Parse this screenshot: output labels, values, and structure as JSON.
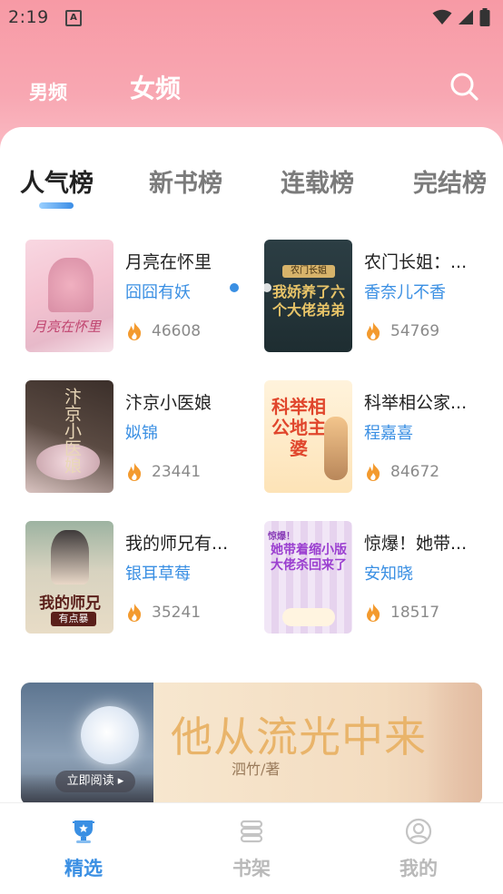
{
  "status_bar": {
    "time": "2:19",
    "notification_letter": "A"
  },
  "header": {
    "tabs": [
      {
        "label": "男频",
        "active": false
      },
      {
        "label": "女频",
        "active": true
      }
    ]
  },
  "rank_tabs": [
    {
      "label": "人气榜",
      "active": true
    },
    {
      "label": "新书榜",
      "active": false
    },
    {
      "label": "连载榜",
      "active": false
    },
    {
      "label": "完结榜",
      "active": false
    }
  ],
  "books": [
    {
      "title": "月亮在怀里",
      "author": "囧囧有妖",
      "heat": "46608",
      "cover_text": "月亮在怀里"
    },
    {
      "title": "农门长姐：...",
      "author": "香奈儿不香",
      "heat": "54769",
      "cover_text": "我娇养了六个大佬弟弟",
      "cover_top_text": "农门长姐"
    },
    {
      "title": "汴京小医娘",
      "author": "姒锦",
      "heat": "23441",
      "cover_text": "汴京小医娘"
    },
    {
      "title": "科举相公家...",
      "author": "程嘉喜",
      "heat": "84672",
      "cover_text": "科举相公地主婆"
    },
    {
      "title": "我的师兄有...",
      "author": "银耳草莓",
      "heat": "35241",
      "cover_text": "我的师兄",
      "cover_sub": "有点暴"
    },
    {
      "title": "惊爆！她带...",
      "author": "安知晓",
      "heat": "18517",
      "cover_text": "她带着缩小版大佬杀回来了",
      "cover_top_text": "惊爆！"
    }
  ],
  "banner": {
    "title": "他从流光中来",
    "author": "泗竹/著",
    "button_label": "立即阅读",
    "page_count": 3,
    "active_index": 0
  },
  "bottom_nav": [
    {
      "label": "精选",
      "icon": "trophy-icon",
      "active": true
    },
    {
      "label": "书架",
      "icon": "bookshelf-icon",
      "active": false
    },
    {
      "label": "我的",
      "icon": "profile-icon",
      "active": false
    }
  ],
  "colors": {
    "accent": "#3a8fe3",
    "header_pink": "#f79aa5",
    "heat_icon": "#f39a2e"
  }
}
